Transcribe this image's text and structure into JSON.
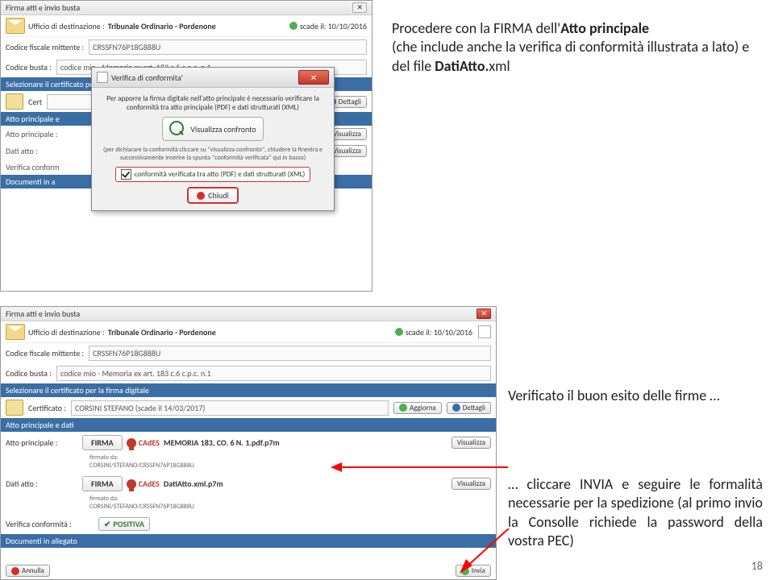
{
  "text": {
    "para1_a": "Procedere con la FIRMA dell'",
    "para1_b": "Atto principale",
    "para1_c": "(che include anche la verifica di conformità illustrata a lato) e del file ",
    "para1_d": "DatiAtto.",
    "para1_e": "xml",
    "para2": "Verificato il buon esito delle firme …",
    "para3": "… cliccare INVIA e seguire le formalità necessarie per la spedizione (al primo invio la Consolle richiede la password della vostra PEC)",
    "page": "18"
  },
  "s1": {
    "title": "Firma atti e invio busta",
    "dest_label": "Ufficio di destinazione :",
    "dest_value": "Tribunale Ordinario - Pordenone",
    "scade": "scade il: 10/10/2016",
    "cf_label": "Codice fiscale mittente :",
    "cf_value": "CRSSFN76P18G888U",
    "cod_busta_label": "Codice busta :",
    "cod_busta_value": "codice mio - Memoria ex art. 183 c.6 c.p.c. n.1",
    "sel_cert": "Selezionare il certificato per la firma digitale",
    "cert_label": "Cert",
    "dettagli": "Dettagli",
    "atto_p_dati": "Atto principale e",
    "atto_p_label": "Atto principale :",
    "dati_atto_label": "Dati atto :",
    "verifica_conf_label": "Verifica conform",
    "doc_alleg_label": "Documenti in a",
    "visualizza": "Visualizza",
    "dlg_title": "Verifica di conformita'",
    "dlg_text": "Per apporre la firma digitale nell'atto principale è necessario verificare la conformità tra atto principale (PDF) e dati strutturati (XML)",
    "vis_confronto": "Visualizza confronto",
    "dlg_para": "(per dichiarare la conformità cliccare su \"visualizza confronto\", chiudere la finestra e successivamente inserire la spunta \"conformità verificata\" qui in basso)",
    "check_label": "conformità verificata tra atto (PDF) e dati strutturati (XML)",
    "chiudi": "Chiudi"
  },
  "s2": {
    "title": "Firma atti e invio busta",
    "dest_label": "Ufficio di destinazione :",
    "dest_value": "Tribunale Ordinario - Pordenone",
    "scade": "scade il: 10/10/2016",
    "cf_label": "Codice fiscale mittente :",
    "cf_value": "CRSSFN76P18G888U",
    "cod_busta_label": "Codice busta :",
    "cod_busta_value": "codice mio - Memoria ex art. 183 c.6 c.p.c. n.1",
    "sel_cert": "Selezionare il certificato per la firma digitale",
    "cert_label": "Certificato :",
    "cert_value": "CORSINI STEFANO (scade il 14/03/2017)",
    "aggiorna": "Aggiorna",
    "dettagli": "Dettagli",
    "atto_p_dati": "Atto principale e dati",
    "atto_p_label": "Atto principale :",
    "firma": "FIRMA",
    "cades": "CAdES",
    "file1": "MEMORIA 183, CO. 6 N. 1.pdf.p7m",
    "firmato_da": "firmato da:",
    "firmato_val": "CORSINI/STEFANO/CRSSFN76P18G888U",
    "dati_atto_label": "Dati atto :",
    "file2": "DatiAtto.xml.p7m",
    "verifica_conf_label": "Verifica conformità :",
    "positiva": "POSITIVA",
    "doc_alleg_label": "Documenti in allegato",
    "visualizza": "Visualizza",
    "annulla": "Annulla",
    "invia": "Invia"
  }
}
